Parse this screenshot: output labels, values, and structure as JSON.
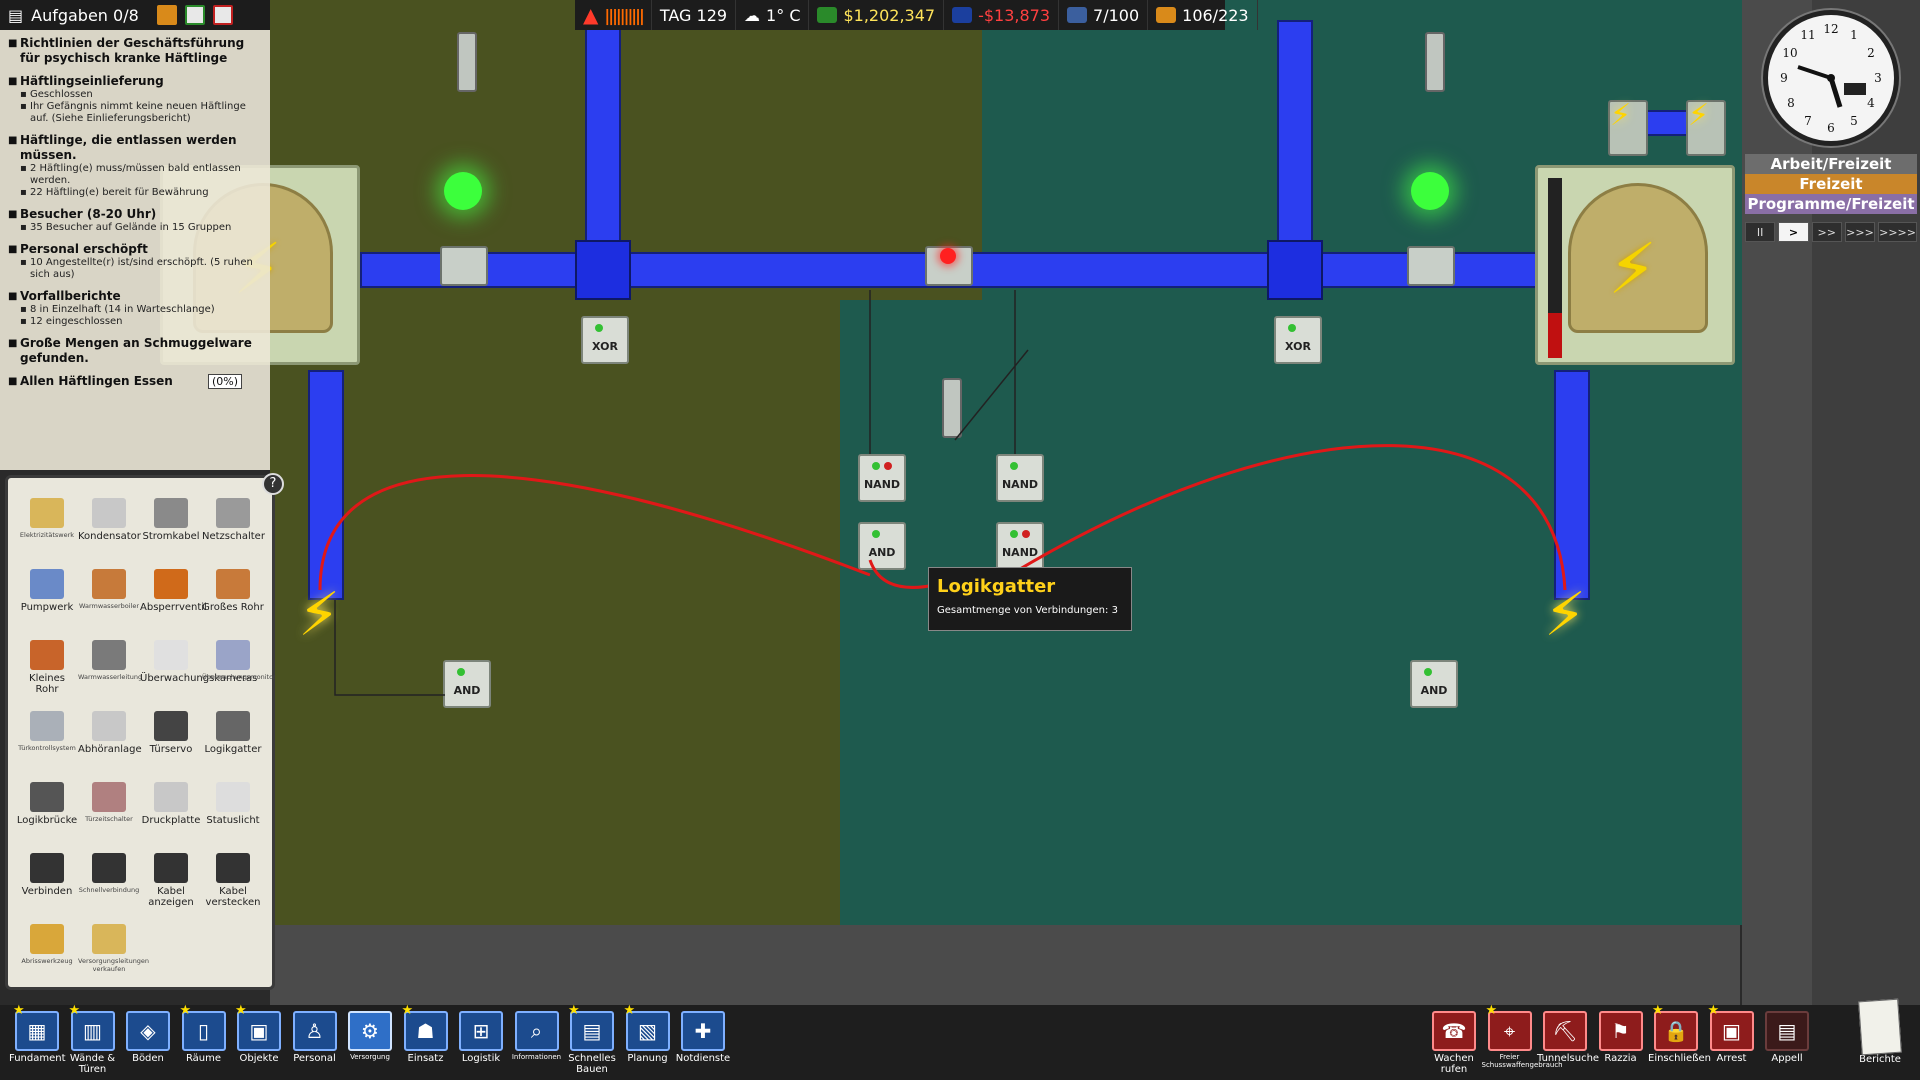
{
  "objectives_header": {
    "title": "Aufgaben 0/8"
  },
  "objectives": [
    {
      "title": "Richtlinien der Geschäftsführung für psychisch kranke Häftlinge",
      "subs": []
    },
    {
      "title": "Häftlingseinlieferung",
      "subs": [
        "Geschlossen",
        "Ihr Gefängnis nimmt keine neuen Häftlinge auf. (Siehe Einlieferungsbericht)"
      ]
    },
    {
      "title": "Häftlinge, die entlassen werden müssen.",
      "subs": [
        "2 Häftling(e) muss/müssen bald entlassen werden.",
        "22 Häftling(e) bereit für Bewährung"
      ]
    },
    {
      "title": "Besucher (8-20 Uhr)",
      "subs": [
        "35 Besucher auf Gelände in 15 Gruppen"
      ]
    },
    {
      "title": "Personal erschöpft",
      "subs": [
        "10 Angestellte(r) ist/sind erschöpft. (5 ruhen sich aus)"
      ]
    },
    {
      "title": "Vorfallberichte",
      "subs": [
        "8 in Einzelhaft (14 in Warteschlange)",
        "12 eingeschlossen"
      ]
    },
    {
      "title": "Große Mengen an Schmuggelware gefunden.",
      "subs": []
    },
    {
      "title": "Allen Häftlingen Essen",
      "subs": [],
      "pct": "(0%)"
    }
  ],
  "topbar": {
    "day": "TAG 129",
    "weather": "1° C",
    "balance": "$1,202,347",
    "cashflow": "-$13,873",
    "staff": "7/100",
    "prisoners": "106/223"
  },
  "schedule": {
    "current": "Arbeit/Freizeit",
    "next": "Freizeit",
    "after": "Programme/Freizeit"
  },
  "speed_controls": [
    "II",
    ">",
    ">>",
    ">>>",
    ">>>>"
  ],
  "tooltip": {
    "title": "Logikgatter",
    "subtitle": "Gesamtmenge von Verbindungen: 3"
  },
  "gates": {
    "xor": "XOR",
    "nand": "NAND",
    "and": "AND"
  },
  "palette": [
    {
      "label": "Elektrizitätswerk",
      "tiny": true,
      "icon": "generator-icon"
    },
    {
      "label": "Kondensator",
      "tiny": false,
      "icon": "capacitor-icon"
    },
    {
      "label": "Stromkabel",
      "tiny": false,
      "icon": "cable-icon"
    },
    {
      "label": "Netzschalter",
      "tiny": false,
      "icon": "power-switch-icon"
    },
    {
      "label": "Pumpwerk",
      "tiny": false,
      "icon": "pump-icon"
    },
    {
      "label": "Warmwasserboiler",
      "tiny": true,
      "icon": "boiler-icon"
    },
    {
      "label": "Absperrventil",
      "tiny": false,
      "icon": "valve-icon"
    },
    {
      "label": "Großes Rohr",
      "tiny": false,
      "icon": "large-pipe-icon"
    },
    {
      "label": "Kleines Rohr",
      "tiny": false,
      "icon": "small-pipe-icon"
    },
    {
      "label": "Warmwasserleitung",
      "tiny": true,
      "icon": "hot-pipe-icon"
    },
    {
      "label": "Überwachungskameras",
      "tiny": false,
      "icon": "camera-icon"
    },
    {
      "label": "Überwachungsmonitor",
      "tiny": true,
      "icon": "monitor-icon"
    },
    {
      "label": "Türkontrollsystem",
      "tiny": true,
      "icon": "door-control-icon"
    },
    {
      "label": "Abhöranlage",
      "tiny": false,
      "icon": "wiretap-icon"
    },
    {
      "label": "Türservo",
      "tiny": false,
      "icon": "door-servo-icon"
    },
    {
      "label": "Logikgatter",
      "tiny": false,
      "icon": "logic-gate-icon"
    },
    {
      "label": "Logikbrücke",
      "tiny": false,
      "icon": "logic-bridge-icon"
    },
    {
      "label": "Türzeitschalter",
      "tiny": true,
      "icon": "door-timer-icon"
    },
    {
      "label": "Druckplatte",
      "tiny": false,
      "icon": "pressure-plate-icon"
    },
    {
      "label": "Statuslicht",
      "tiny": false,
      "icon": "status-light-icon"
    },
    {
      "label": "Verbinden",
      "tiny": false,
      "icon": "connect-icon"
    },
    {
      "label": "Schnellverbindung",
      "tiny": true,
      "icon": "quick-connect-icon"
    },
    {
      "label": "Kabel anzeigen",
      "tiny": false,
      "icon": "show-cables-icon"
    },
    {
      "label": "Kabel verstecken",
      "tiny": false,
      "icon": "hide-cables-icon"
    },
    {
      "label": "Abrisswerkzeug",
      "tiny": true,
      "icon": "demolish-icon"
    },
    {
      "label": "Versorgungsleitungen verkaufen",
      "tiny": true,
      "icon": "sell-utilities-icon"
    }
  ],
  "bottom_toolbar": [
    {
      "label": "Fundament",
      "tiny": false,
      "icon": "foundation-icon",
      "star": true
    },
    {
      "label": "Wände & Türen",
      "tiny": false,
      "icon": "walls-icon",
      "star": true
    },
    {
      "label": "Böden",
      "tiny": false,
      "icon": "floors-icon",
      "star": false
    },
    {
      "label": "Räume",
      "tiny": false,
      "icon": "rooms-icon",
      "star": true
    },
    {
      "label": "Objekte",
      "tiny": false,
      "icon": "objects-icon",
      "star": true
    },
    {
      "label": "Personal",
      "tiny": false,
      "icon": "staff-icon",
      "star": false
    },
    {
      "label": "Versorgung",
      "tiny": true,
      "icon": "utilities-icon",
      "star": false,
      "active": true
    },
    {
      "label": "Einsatz",
      "tiny": false,
      "icon": "deploy-icon",
      "star": true
    },
    {
      "label": "Logistik",
      "tiny": false,
      "icon": "logistics-icon",
      "star": false
    },
    {
      "label": "Informationen",
      "tiny": true,
      "icon": "info-icon",
      "star": false
    },
    {
      "label": "Schnelles Bauen",
      "tiny": false,
      "icon": "quickbuild-icon",
      "star": true
    },
    {
      "label": "Planung",
      "tiny": false,
      "icon": "planning-icon",
      "star": true
    },
    {
      "label": "Notdienste",
      "tiny": false,
      "icon": "emergency-icon",
      "star": false
    }
  ],
  "bottom_right": [
    {
      "label": "Wachen rufen",
      "tiny": false,
      "icon": "call-guards-icon",
      "star": false
    },
    {
      "label": "Freier Schusswaffengebrauch",
      "tiny": true,
      "icon": "shoot-icon",
      "star": true
    },
    {
      "label": "Tunnelsuche",
      "tiny": false,
      "icon": "tunnel-icon",
      "star": false
    },
    {
      "label": "Razzia",
      "tiny": false,
      "icon": "shakedown-icon",
      "star": false
    },
    {
      "label": "Einschließen",
      "tiny": false,
      "icon": "lockdown-icon",
      "star": true
    },
    {
      "label": "Arrest",
      "tiny": false,
      "icon": "bang-up-icon",
      "star": true
    },
    {
      "label": "Appell",
      "tiny": false,
      "icon": "rollcall-icon",
      "star": false
    }
  ],
  "reports_label": "Berichte",
  "help_label": "?",
  "colors": {
    "olive": "#4a5220",
    "teal": "#1e5a4e",
    "pipe": "#2c3ef0",
    "wire": "#e01818",
    "warning": "#ffd11a"
  }
}
